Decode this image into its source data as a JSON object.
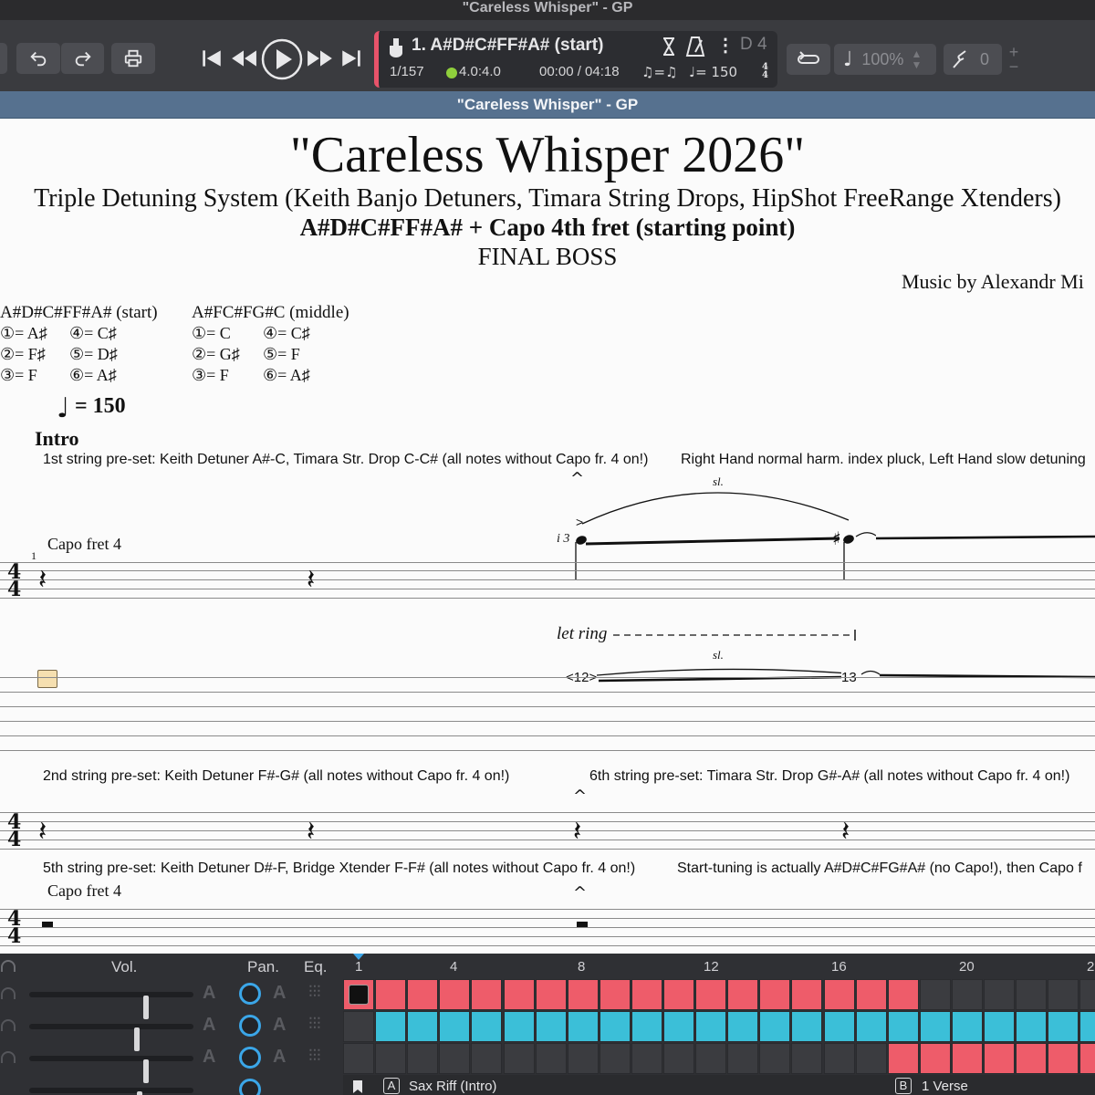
{
  "window": {
    "title": "\"Careless Whisper\" - GP"
  },
  "toolbar": {
    "lcd": {
      "track_name": "1. A#D#C#FF#A# (start)",
      "bar_position": "1/157",
      "time_signature": "4.0:4.0",
      "time": "00:00 / 04:18",
      "triplet_feel": "♫=♫",
      "tempo": "♩= 150",
      "key": "D 4"
    },
    "zoom": "100%",
    "pitch_value": "0"
  },
  "doc_strip": {
    "title": "\"Careless Whisper\" - GP"
  },
  "score": {
    "title": "\"Careless Whisper 2026\"",
    "subtitle": "Triple Detuning System (Keith Banjo Detuners, Timara String Drops, HipShot FreeRange Xtenders)",
    "subtitle2": "A#D#C#FF#A# + Capo 4th fret (starting point)",
    "subtitle3": "FINAL BOSS",
    "credit": "Music by Alexandr Mi",
    "tuning_start": {
      "name": "A#D#C#FF#A# (start)",
      "s1": "①= A♯",
      "s2": "②= F♯",
      "s3": "③= F",
      "s4": "④= C♯",
      "s5": "⑤= D♯",
      "s6": "⑥= A♯"
    },
    "tuning_middle": {
      "name": "A#FC#FG#C (middle)",
      "s1": "①= C",
      "s2": "②= G♯",
      "s3": "③= F",
      "s4": "④= C♯",
      "s5": "⑤= F",
      "s6": "⑥= A♯"
    },
    "tempo_value": "= 150",
    "section": "Intro",
    "note1_left": "1st string pre-set: Keith Detuner A#-C, Timara Str. Drop C-C# (all notes without Capo fr. 4 on!)",
    "note1_right": "Right Hand normal harm. index pluck, Left Hand slow detuning",
    "bar_number": "1",
    "capo1": "Capo fret 4",
    "slide1": "sl.",
    "slide2": "sl.",
    "fingering": "i 3",
    "let_ring": "let ring",
    "tab_fret1": "<12>",
    "tab_fret2": "13",
    "note2_left": "2nd string pre-set: Keith Detuner F#-G# (all notes without Capo fr. 4 on!)",
    "note2_right": "6th string pre-set: Timara Str. Drop G#-A# (all notes without Capo fr. 4 on!)",
    "note3_left": "5th string pre-set: Keith Detuner D#-F, Bridge Xtender F-F# (all notes without Capo fr. 4 on!)",
    "note3_right": "Start-tuning is actually A#D#C#FG#A# (no Capo!), then Capo f",
    "capo2": "Capo fret 4",
    "time_sig_top": "4",
    "time_sig_bottom": "4"
  },
  "mixer": {
    "vol_label": "Vol.",
    "pan_label": "Pan.",
    "eq_label": "Eq.",
    "auto_letter": "A",
    "ruler": [
      "1",
      "4",
      "8",
      "12",
      "16",
      "20",
      "2"
    ],
    "tracks": [
      {
        "volume": 0.72
      },
      {
        "volume": 0.66
      },
      {
        "volume": 0.72
      },
      {
        "volume": 0.68
      }
    ],
    "markers": [
      {
        "letter": "A",
        "name": "Sax Riff (Intro)"
      },
      {
        "letter": "B",
        "name": "1 Verse"
      }
    ]
  },
  "colors": {
    "red_track": "#ee5c6a",
    "blue_track": "#3bbfd8",
    "empty_cell": "#3b3c40",
    "accent": "#3ba6e8"
  }
}
